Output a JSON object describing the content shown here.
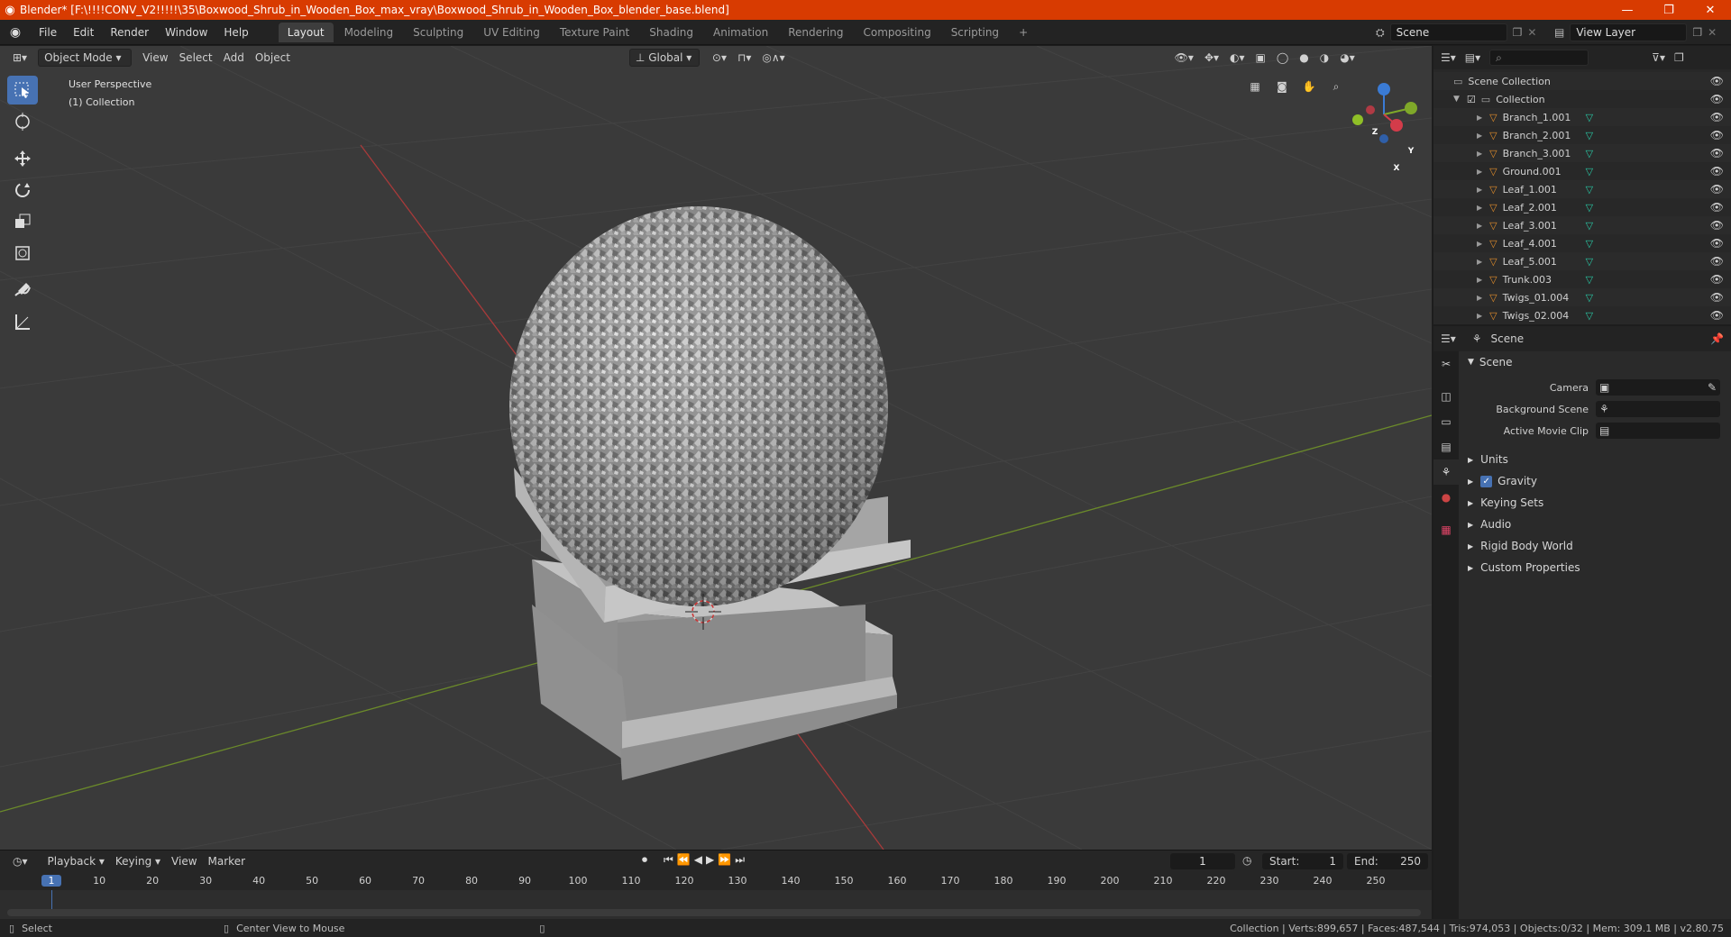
{
  "titlebar": {
    "title": "Blender* [F:\\!!!!CONV_V2!!!!!\\35\\Boxwood_Shrub_in_Wooden_Box_max_vray\\Boxwood_Shrub_in_Wooden_Box_blender_base.blend]",
    "minimize": "—",
    "restore": "❐",
    "close": "✕"
  },
  "menubar": {
    "items": [
      "File",
      "Edit",
      "Render",
      "Window",
      "Help"
    ],
    "workspaces": [
      "Layout",
      "Modeling",
      "Sculpting",
      "UV Editing",
      "Texture Paint",
      "Shading",
      "Animation",
      "Rendering",
      "Compositing",
      "Scripting"
    ],
    "active_workspace": "Layout",
    "add_workspace": "+",
    "scene": "Scene",
    "view_layer": "View Layer"
  },
  "viewport": {
    "mode": "Object Mode",
    "menus": [
      "View",
      "Select",
      "Add",
      "Object"
    ],
    "transform_orientation": "Global",
    "overlay_line1": "User Perspective",
    "overlay_line2": "(1) Collection",
    "gizmo_axes": {
      "x": "X",
      "y": "Y",
      "z": "Z"
    },
    "colors": {
      "bg": "#3a3a3a",
      "grid": "#454545",
      "x_axis": "#a83a3a",
      "y_axis": "#6b8a2a"
    }
  },
  "outliner": {
    "search_placeholder": "",
    "root": "Scene Collection",
    "collection": "Collection",
    "items": [
      "Branch_1.001",
      "Branch_2.001",
      "Branch_3.001",
      "Ground.001",
      "Leaf_1.001",
      "Leaf_2.001",
      "Leaf_3.001",
      "Leaf_4.001",
      "Leaf_5.001",
      "Trunk.003",
      "Twigs_01.004",
      "Twigs_02.004"
    ]
  },
  "properties": {
    "header": "Scene",
    "panel": "Scene",
    "camera_label": "Camera",
    "background_scene_label": "Background Scene",
    "active_movie_clip_label": "Active Movie Clip",
    "sections": [
      "Units",
      "Gravity",
      "Keying Sets",
      "Audio",
      "Rigid Body World",
      "Custom Properties"
    ],
    "gravity_checked": true
  },
  "timeline": {
    "menus": [
      "Playback",
      "Keying",
      "View",
      "Marker"
    ],
    "current_frame": "1",
    "start_label": "Start:",
    "start": "1",
    "end_label": "End:",
    "end": "250",
    "ticks": [
      "1",
      "10",
      "20",
      "30",
      "40",
      "50",
      "60",
      "70",
      "80",
      "90",
      "100",
      "110",
      "120",
      "130",
      "140",
      "150",
      "160",
      "170",
      "180",
      "190",
      "200",
      "210",
      "220",
      "230",
      "240",
      "250"
    ]
  },
  "statusbar": {
    "left": "Select",
    "middle": "Center View to Mouse",
    "right": "Collection | Verts:899,657 | Faces:487,544 | Tris:974,053 | Objects:0/32 | Mem: 309.1 MB | v2.80.75"
  }
}
